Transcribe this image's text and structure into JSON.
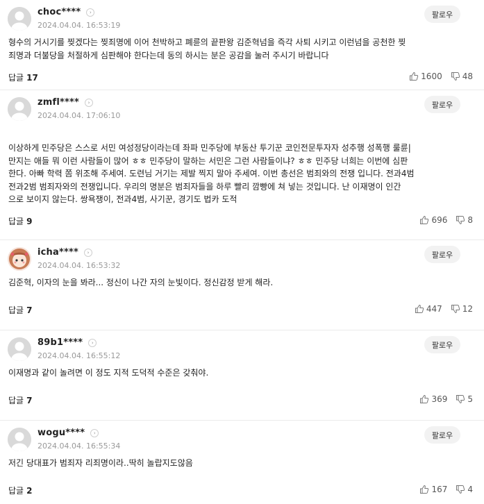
{
  "comments": [
    {
      "user": "choc****",
      "time": "2024.04.04. 16:53:19",
      "follow": "팔로우",
      "text": "형수의 거시기를 찢겠다는 찢죄명에 이어 천박하고 폐륜의 끝판왕 김준혁넘을 즉각 사퇴 시키고 이런넘을 공천한 찢\n죄명과 더불당을 처절하게 심판해야 한다는데 동의 하시는 분은 공감을 눌러 주시기 바랍니다",
      "reply_label": "답글",
      "reply_count": "17",
      "likes": "1600",
      "dislikes": "48"
    },
    {
      "user": "zmfl****",
      "time": "2024.04.04. 17:06:10",
      "follow": "팔로우",
      "text": "이상하게 민주당은 스스로 서민 여성정당이라는데 좌파 민주당에 부동산 투기꾼 코인전문투자자 성추행 성폭행 룰륜|\n만지는 애들 뭐 이런 사람들이 많어 ㅎㅎ 민주당이 말하는 서민은 그런 사람들이냐? ㅎㅎ 민주당 너희는 이번에 심판\n한다. 아빠 학력 쫌 위조해 주세여. 도련님 거기는 제발 찍지 말아 주세여. 이번 총선은 범죄와의 전쟁 입니다. 전과4범\n전과2범 범죄자와의 전쟁입니다. 우리의 명분은 범죄자들을 하루 빨리 깜빵에 쳐 넣는 것입니다. 난 이재명이 인간\n으로 보이지 않는다. 쌍욕쟁이, 전과4범, 사기꾼, 경기도 법카 도적",
      "reply_label": "답글",
      "reply_count": "9",
      "likes": "696",
      "dislikes": "8"
    },
    {
      "user": "icha****",
      "time": "2024.04.04. 16:53:32",
      "follow": "팔로우",
      "text": "김준혁, 이자의 눈을 봐라... 정신이 나간 자의 눈빛이다. 정신감정 받게 해라.",
      "reply_label": "답글",
      "reply_count": "7",
      "likes": "447",
      "dislikes": "12"
    },
    {
      "user": "89b1****",
      "time": "2024.04.04. 16:55:12",
      "follow": "팔로우",
      "text": "이재명과 같이 놀려면 이 정도 지적 도덕적 수준은 갖춰야.",
      "reply_label": "답글",
      "reply_count": "7",
      "likes": "369",
      "dislikes": "5"
    },
    {
      "user": "wogu****",
      "time": "2024.04.04. 16:55:34",
      "follow": "팔로우",
      "text": "저긴 당대표가 범죄자 리죄명이라..딱히 놀랍지도않음",
      "reply_label": "답글",
      "reply_count": "2",
      "likes": "167",
      "dislikes": "4"
    }
  ]
}
